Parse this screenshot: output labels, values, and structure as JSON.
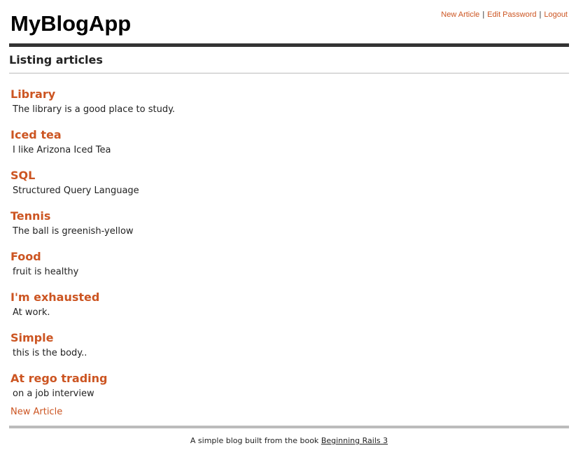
{
  "header": {
    "app_title": "MyBlogApp",
    "nav": [
      {
        "label": "New Article"
      },
      {
        "label": "Edit Password"
      },
      {
        "label": "Logout"
      }
    ],
    "separator": "|"
  },
  "main": {
    "section_title": "Listing articles",
    "articles": [
      {
        "title": "Library",
        "body": "The library is a good place to study."
      },
      {
        "title": "Iced tea",
        "body": "I like Arizona Iced Tea"
      },
      {
        "title": "SQL",
        "body": "Structured Query Language"
      },
      {
        "title": "Tennis",
        "body": "The ball is greenish-yellow"
      },
      {
        "title": "Food",
        "body": "fruit is healthy"
      },
      {
        "title": "I'm exhausted",
        "body": "At work."
      },
      {
        "title": "Simple",
        "body": "this is the body.."
      },
      {
        "title": "At rego trading",
        "body": "on a job interview"
      }
    ],
    "new_article_label": "New Article"
  },
  "footer": {
    "text": "A simple blog built from the book",
    "link_label": "Beginning Rails 3"
  },
  "colors": {
    "link": "#cc5522",
    "rule_dark": "#333333",
    "rule_light": "#bbbbbb"
  }
}
